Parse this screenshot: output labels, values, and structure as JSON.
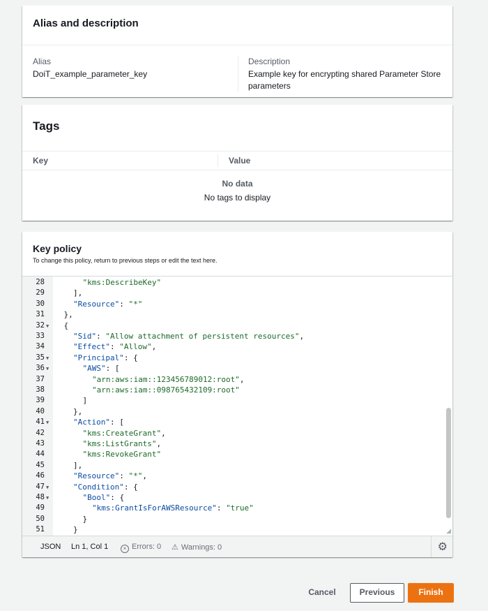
{
  "alias_section": {
    "title": "Alias and description",
    "alias_label": "Alias",
    "alias_value": "DoiT_example_parameter_key",
    "description_label": "Description",
    "description_value_line1": "Example key for encrypting shared Parameter Store",
    "description_value_line2": "parameters"
  },
  "tags_section": {
    "title": "Tags",
    "columns": [
      "Key",
      "Value"
    ],
    "empty_title": "No data",
    "empty_message": "No tags to display"
  },
  "policy_section": {
    "title": "Key policy",
    "description": "To change this policy, return to previous steps or edit the text here.",
    "lines": [
      {
        "n": "28",
        "fold": false,
        "indent": 5,
        "text": "\"kms:DescribeKey\""
      },
      {
        "n": "29",
        "fold": false,
        "indent": 4,
        "text": "],"
      },
      {
        "n": "30",
        "fold": false,
        "indent": 4,
        "text": "\"Resource\": \"*\""
      },
      {
        "n": "31",
        "fold": false,
        "indent": 3,
        "text": "},"
      },
      {
        "n": "32",
        "fold": true,
        "indent": 3,
        "text": "{"
      },
      {
        "n": "33",
        "fold": false,
        "indent": 4,
        "text": "\"Sid\": \"Allow attachment of persistent resources\","
      },
      {
        "n": "34",
        "fold": false,
        "indent": 4,
        "text": "\"Effect\": \"Allow\","
      },
      {
        "n": "35",
        "fold": true,
        "indent": 4,
        "text": "\"Principal\": {"
      },
      {
        "n": "36",
        "fold": true,
        "indent": 5,
        "text": "\"AWS\": ["
      },
      {
        "n": "37",
        "fold": false,
        "indent": 6,
        "text": "\"arn:aws:iam::123456789012:root\","
      },
      {
        "n": "38",
        "fold": false,
        "indent": 6,
        "text": "\"arn:aws:iam::098765432109:root\""
      },
      {
        "n": "39",
        "fold": false,
        "indent": 5,
        "text": "]"
      },
      {
        "n": "40",
        "fold": false,
        "indent": 4,
        "text": "},"
      },
      {
        "n": "41",
        "fold": true,
        "indent": 4,
        "text": "\"Action\": ["
      },
      {
        "n": "42",
        "fold": false,
        "indent": 5,
        "text": "\"kms:CreateGrant\","
      },
      {
        "n": "43",
        "fold": false,
        "indent": 5,
        "text": "\"kms:ListGrants\","
      },
      {
        "n": "44",
        "fold": false,
        "indent": 5,
        "text": "\"kms:RevokeGrant\""
      },
      {
        "n": "45",
        "fold": false,
        "indent": 4,
        "text": "],"
      },
      {
        "n": "46",
        "fold": false,
        "indent": 4,
        "text": "\"Resource\": \"*\","
      },
      {
        "n": "47",
        "fold": true,
        "indent": 4,
        "text": "\"Condition\": {"
      },
      {
        "n": "48",
        "fold": true,
        "indent": 5,
        "text": "\"Bool\": {"
      },
      {
        "n": "49",
        "fold": false,
        "indent": 6,
        "text": "\"kms:GrantIsForAWSResource\": \"true\""
      },
      {
        "n": "50",
        "fold": false,
        "indent": 5,
        "text": "}"
      },
      {
        "n": "51",
        "fold": false,
        "indent": 4,
        "text": "}"
      }
    ],
    "status": {
      "mode": "JSON",
      "cursor": "Ln 1, Col 1",
      "errors": "Errors: 0",
      "warnings": "Warnings: 0"
    }
  },
  "footer": {
    "cancel_label": "Cancel",
    "previous_label": "Previous",
    "finish_label": "Finish"
  },
  "colors": {
    "primary_button": "#ec7211",
    "json_string": "#1d6a2a",
    "json_key": "#0b4ca3"
  }
}
